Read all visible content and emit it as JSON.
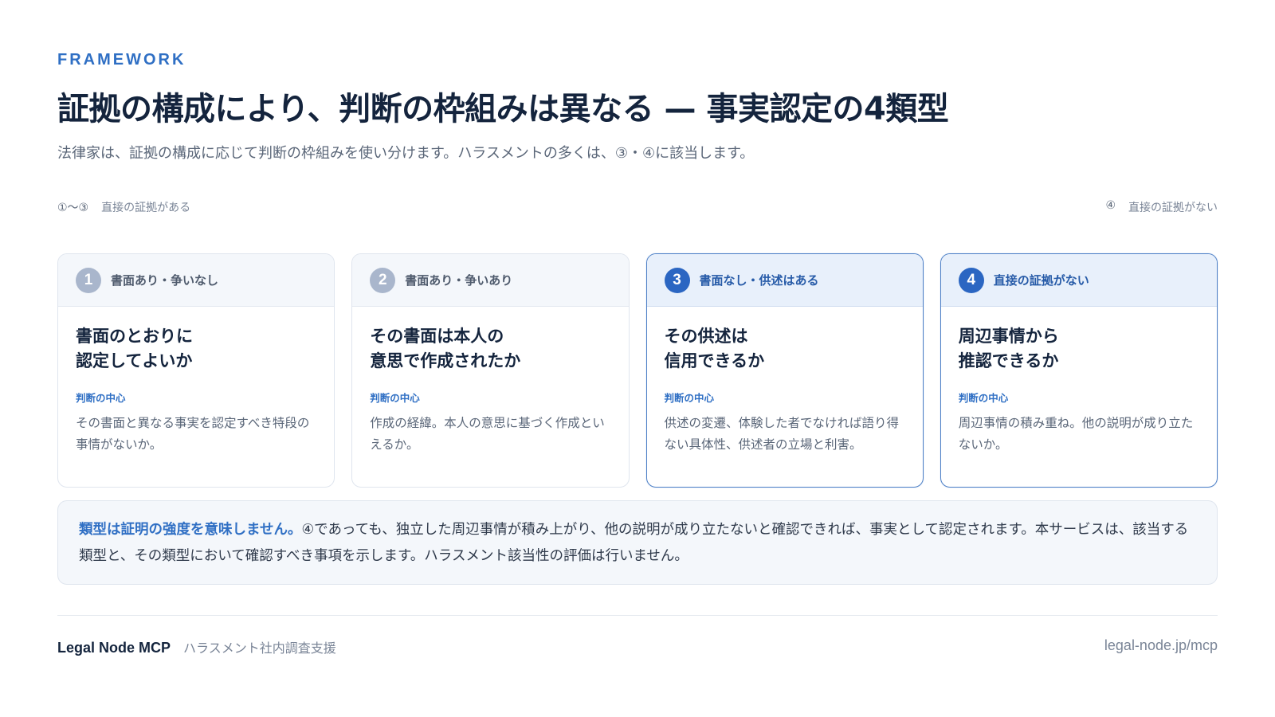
{
  "header": {
    "eyebrow": "FRAMEWORK",
    "title": "証拠の構成により、判断の枠組みは異なる — 事実認定の4類型",
    "subtitle": "法律家は、証拠の構成に応じて判断の枠組みを使い分けます。ハラスメントの多くは、③・④に該当します。"
  },
  "range": {
    "left_mark": "①〜③",
    "left_label": "直接の証拠がある",
    "right_mark": "④",
    "right_label": "直接の証拠がない"
  },
  "cards": [
    {
      "number": "1",
      "head": "書面あり・争いなし",
      "question": "書面のとおりに\n認定してよいか",
      "key_label": "判断の中心",
      "description": "その書面と異なる事実を認定すべき特段の事情がないか。"
    },
    {
      "number": "2",
      "head": "書面あり・争いあり",
      "question": "その書面は本人の\n意思で作成されたか",
      "key_label": "判断の中心",
      "description": "作成の経緯。本人の意思に基づく作成といえるか。"
    },
    {
      "number": "3",
      "head": "書面なし・供述はある",
      "question": "その供述は\n信用できるか",
      "key_label": "判断の中心",
      "description": "供述の変遷、体験した者でなければ語り得ない具体性、供述者の立場と利害。"
    },
    {
      "number": "4",
      "head": "直接の証拠がない",
      "question": "周辺事情から\n推認できるか",
      "key_label": "判断の中心",
      "description": "周辺事情の積み重ね。他の説明が成り立たないか。"
    }
  ],
  "note": {
    "emphasis": "類型は証明の強度を意味しません。",
    "body": "④であっても、独立した周辺事情が積み上がり、他の説明が成り立たないと確認できれば、事実として認定されます。本サービスは、該当する類型と、その類型において確認すべき事項を示します。ハラスメント該当性の評価は行いません。"
  },
  "footer": {
    "brand": "Legal Node MCP",
    "brand_sub": "ハラスメント社内調査支援",
    "url": "legal-node.jp/mcp"
  },
  "colors": {
    "accent": "#2f6fc4",
    "active_number": "#2b66c2",
    "inactive_number": "#a9b6cc",
    "title": "#14243d"
  }
}
